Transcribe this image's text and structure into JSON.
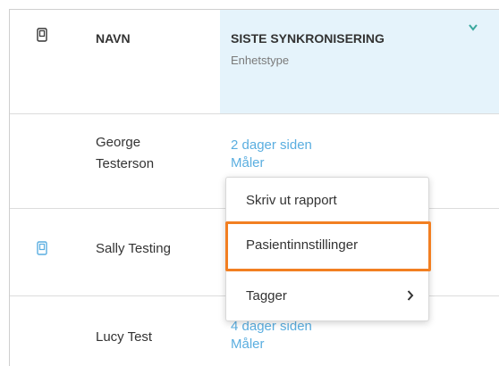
{
  "table": {
    "header": {
      "name_label": "NAVN",
      "sync_label": "SISTE SYNKRONISERING",
      "device_type_label": "Enhetstype"
    },
    "rows": [
      {
        "name_line1": "George",
        "name_line2": "Testerson",
        "sync": "2 dager siden",
        "device": "Måler",
        "has_device_icon": false
      },
      {
        "name": "Sally Testing",
        "has_device_icon": true
      },
      {
        "name": "Lucy Test",
        "sync": "4 dager siden",
        "device": "Måler",
        "has_device_icon": false
      }
    ]
  },
  "context_menu": {
    "items": [
      {
        "label": "Skriv ut rapport"
      },
      {
        "label": "Pasientinnstillinger",
        "highlighted": true
      },
      {
        "label": "Tagger",
        "has_submenu": true
      }
    ]
  },
  "colors": {
    "link": "#5aaee0",
    "sorted_column_bg": "#e5f3fb",
    "highlight_border": "#f27f22",
    "teal_accent": "#3aa89e"
  }
}
